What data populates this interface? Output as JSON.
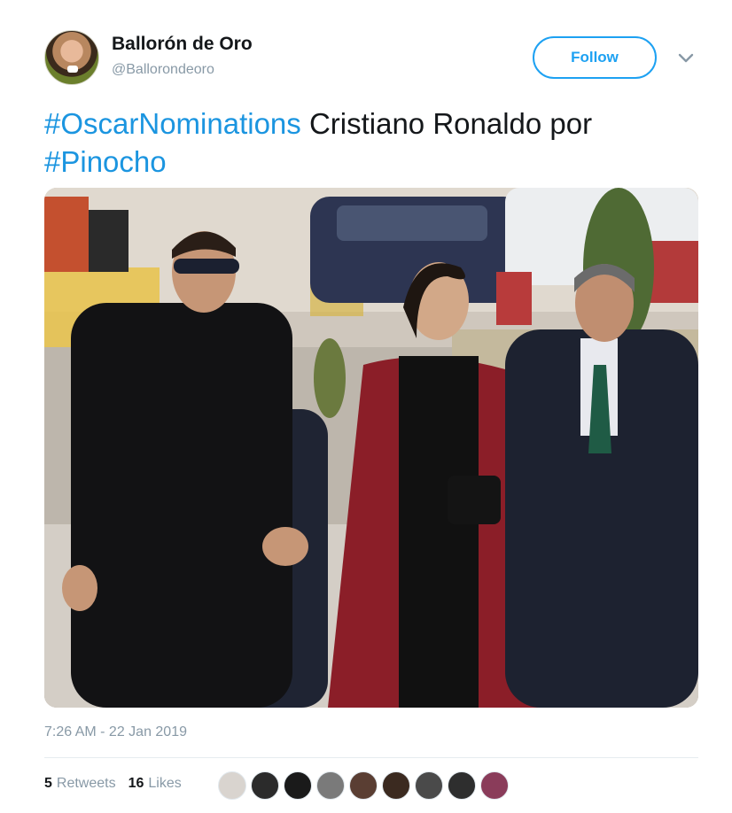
{
  "user": {
    "display_name": "Ballorón de Oro",
    "handle": "@Ballorondeoro",
    "avatar_icon": "profile-avatar"
  },
  "follow_label": "Follow",
  "text": {
    "hashtag1": "#OscarNominations",
    "body": " Cristiano Ronaldo por ",
    "hashtag2": "#Pinocho"
  },
  "photo": {
    "description_icon": "photo-image"
  },
  "timestamp": "7:26 AM - 22 Jan 2019",
  "stats": {
    "retweets_count": "5",
    "retweets_label": "Retweets",
    "likes_count": "16",
    "likes_label": "Likes"
  },
  "colors": {
    "link": "#1b95e0",
    "follow": "#1da1f2",
    "muted": "#8899a6"
  },
  "liker_avatars": [
    "#d9d4cf",
    "#2b2b2b",
    "#1a1a1a",
    "#7a7a7a",
    "#5a3e33",
    "#3b2a20",
    "#4a4a4a",
    "#2e2e2e",
    "#8a3c5a"
  ]
}
